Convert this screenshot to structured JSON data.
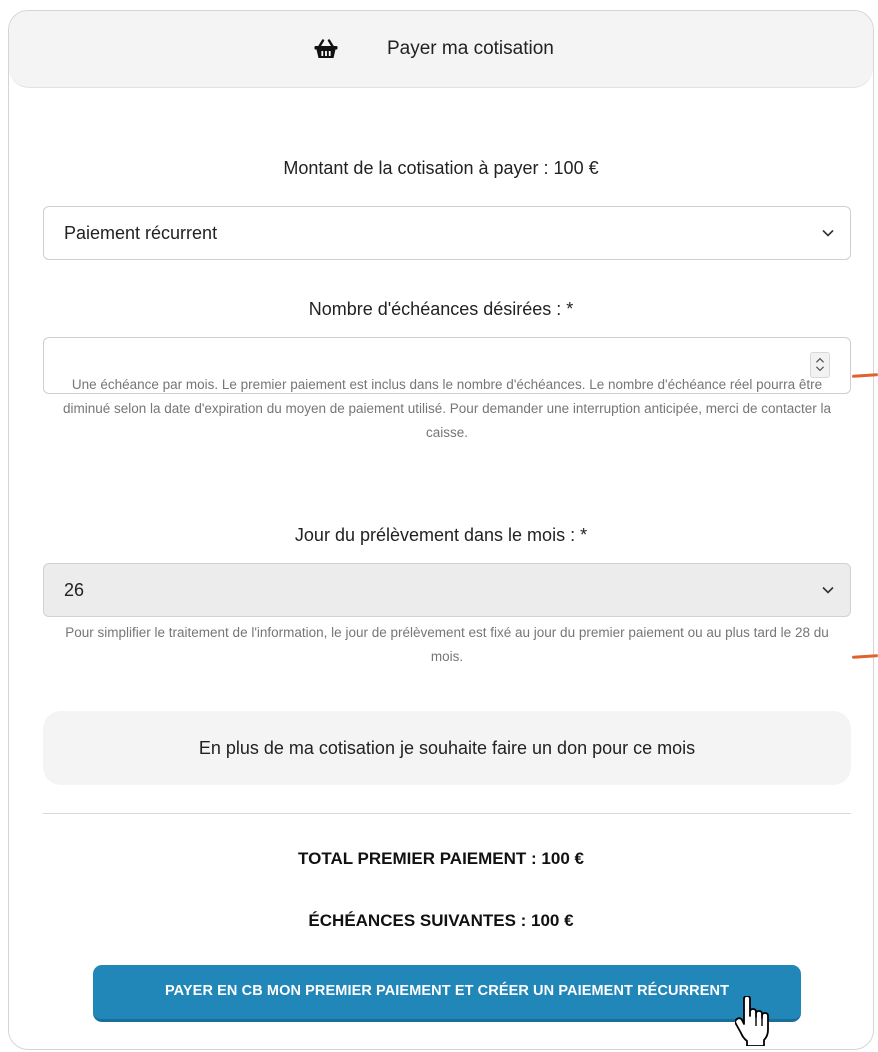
{
  "header": {
    "icon": "basket-icon",
    "title": "Payer ma cotisation"
  },
  "amount_text": "Montant de la cotisation à payer : 100 €",
  "payment_type": {
    "selected": "Paiement récurrent"
  },
  "installments": {
    "label": "Nombre d'échéances désirées : *",
    "value": "",
    "help": "Une échéance par mois. Le premier paiement est inclus dans le nombre d'échéances. Le nombre d'échéance réel pourra être diminué selon la date d'expiration du moyen de paiement utilisé. Pour demander une interruption anticipée, merci de contacter la caisse."
  },
  "debit_day": {
    "label": "Jour du prélèvement dans le mois : *",
    "selected": "26",
    "help": "Pour simplifier le traitement de l'information, le jour de prélèvement est fixé au jour du premier paiement ou au plus tard le 28 du mois."
  },
  "donation_text": "En plus de ma cotisation je souhaite faire un don pour ce mois",
  "totals": {
    "first_payment": "TOTAL PREMIER PAIEMENT : 100 €",
    "following": "ÉCHÉANCES SUIVANTES : 100 €"
  },
  "pay_button": "PAYER EN CB MON PREMIER PAIEMENT ET CRÉER UN PAIEMENT RÉCURRENT",
  "colors": {
    "accent": "#2186b8",
    "card_header_bg": "#f4f4f4",
    "help_text": "#767676",
    "annotation_mark": "#e0622e"
  }
}
